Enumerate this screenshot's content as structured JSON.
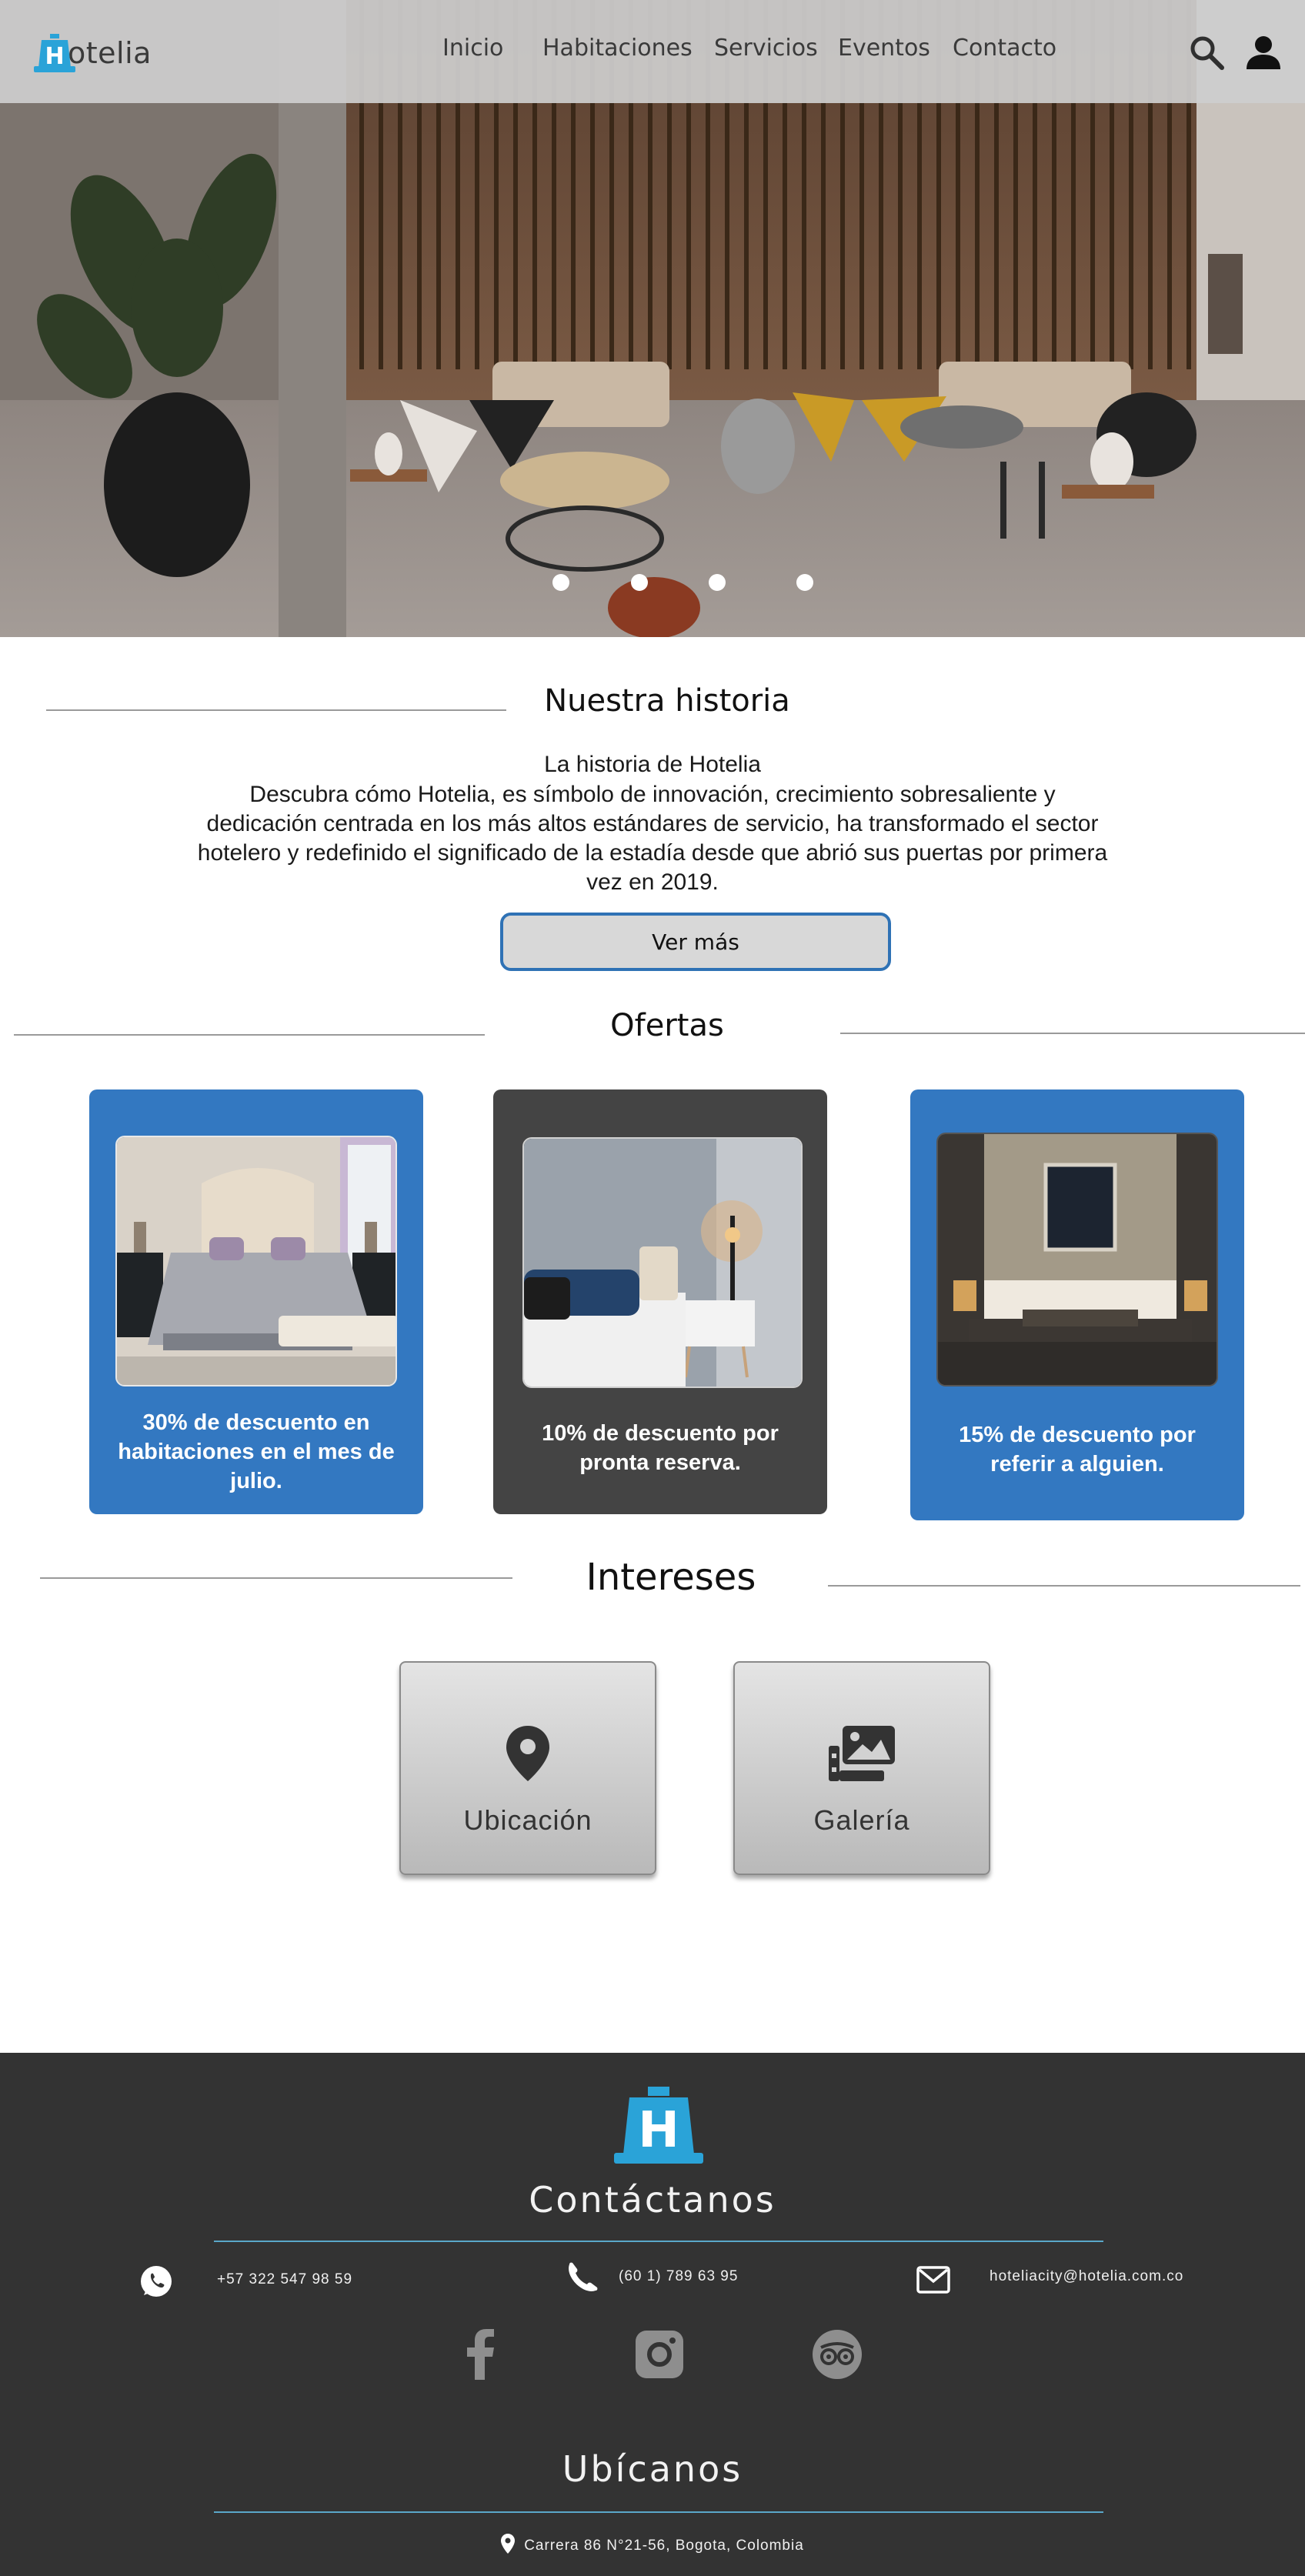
{
  "brand": {
    "name": "otelia",
    "logo_letter": "H"
  },
  "nav": {
    "items": [
      "Inicio",
      "Habitaciones",
      "Servicios",
      "Eventos",
      "Contacto"
    ],
    "icons": [
      "search-icon",
      "user-icon"
    ]
  },
  "hero": {
    "slide_count": 4
  },
  "story": {
    "heading": "Nuestra historia",
    "subtitle": "La historia de Hotelia",
    "body": "Descubra cómo Hotelia, es símbolo de innovación, crecimiento sobresaliente y dedicación centrada en los más altos estándares de servicio, ha transformado el sector hotelero y redefinido el significado de la estadía desde que abrió sus puertas por primera vez en 2019.",
    "button": "Ver más"
  },
  "offers": {
    "heading": "Ofertas",
    "cards": [
      {
        "text": "30% de descuento en habitaciones en el mes de julio.",
        "color": "#3378c1"
      },
      {
        "text": "10% de descuento por pronta reserva.",
        "color": "#444444"
      },
      {
        "text": "15% de descuento por referir a alguien.",
        "color": "#3378c1"
      }
    ]
  },
  "interests": {
    "heading": "Intereses",
    "items": [
      {
        "label": "Ubicación",
        "icon": "location-pin-icon"
      },
      {
        "label": "Galería",
        "icon": "gallery-icon"
      }
    ]
  },
  "footer": {
    "contact_heading": "Contáctanos",
    "whatsapp": "+57 322 547 98 59",
    "phone": "(60 1) 789 63 95",
    "email": "hoteliacity@hotelia.com.co",
    "social": [
      "facebook-icon",
      "instagram-icon",
      "tripadvisor-icon"
    ],
    "location_heading": "Ubícanos",
    "address": "Carrera 86 N°21-56, Bogota, Colombia"
  },
  "colors": {
    "accent": "#3378c1",
    "footer": "#333333",
    "logo": "#2aa3d8",
    "rule": "#5aa7c9"
  }
}
